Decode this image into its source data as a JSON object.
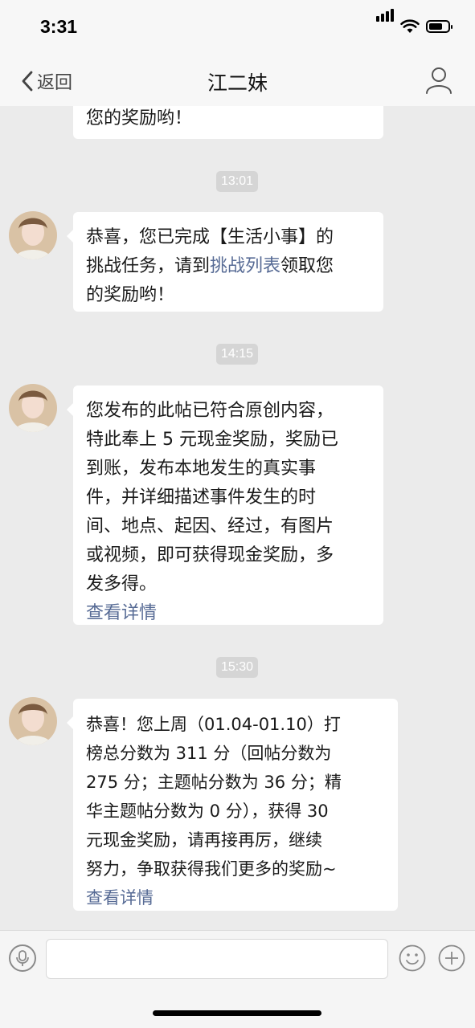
{
  "status_bar": {
    "time": "3:31"
  },
  "nav": {
    "back_label": "返回",
    "title": "江二妹"
  },
  "messages": [
    {
      "lines": [
        "您的奖励哟！"
      ]
    },
    {
      "time": "13:01",
      "lines_pre": [
        "恭喜，您已完成【生活小事】的",
        "挑战任务，请到"
      ],
      "link": "挑战列表",
      "link_suffix": "领取您",
      "lines_post": [
        "的奖励哟！"
      ]
    },
    {
      "time": "14:15",
      "lines": [
        "您发布的此帖已符合原创内容，",
        "特此奉上 5 元现金奖励，奖励已",
        "到账，发布本地发生的真实事",
        "件，并详细描述事件发生的时",
        "间、地点、起因、经过，有图片",
        "或视频，即可获得现金奖励，多",
        "发多得。"
      ],
      "link": "查看详情"
    },
    {
      "time": "15:30",
      "lines": [
        "恭喜！您上周（01.04-01.10）打",
        "榜总分数为 311 分（回帖分数为",
        "275 分；主题帖分数为 36 分；精",
        "华主题帖分数为 0 分），获得 30",
        "元现金奖励，请再接再厉，继续",
        "努力，争取获得我们更多的奖励~"
      ],
      "link": "查看详情"
    }
  ],
  "input": {
    "value": "",
    "placeholder": ""
  },
  "icons": [
    "back-chevron-icon",
    "profile-icon",
    "voice-icon",
    "emoji-icon",
    "plus-icon"
  ]
}
